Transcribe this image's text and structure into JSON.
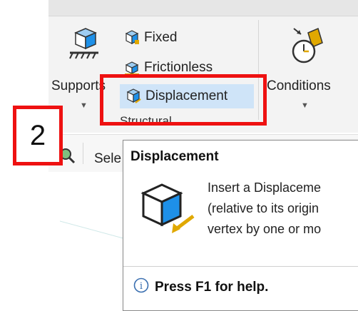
{
  "step_marker": "2",
  "ribbon": {
    "supports": {
      "label": "Supports"
    },
    "fixed": {
      "label": "Fixed"
    },
    "frictionless": {
      "label": "Frictionless"
    },
    "displacement": {
      "label": "Displacement"
    },
    "group_label": "Structural",
    "conditions": {
      "label": "Conditions"
    }
  },
  "command_bar": {
    "select_text": "Sele"
  },
  "tooltip": {
    "title": "Displacement",
    "lines": [
      "Insert a Displaceme",
      "(relative to its origin",
      "vertex by one or mo"
    ],
    "help": "Press F1 for help."
  },
  "colors": {
    "highlight": "#cfe4f8",
    "callout_red": "#ee1111",
    "cube_blue": "#1e90e8",
    "arrow_gold": "#e0a800"
  }
}
